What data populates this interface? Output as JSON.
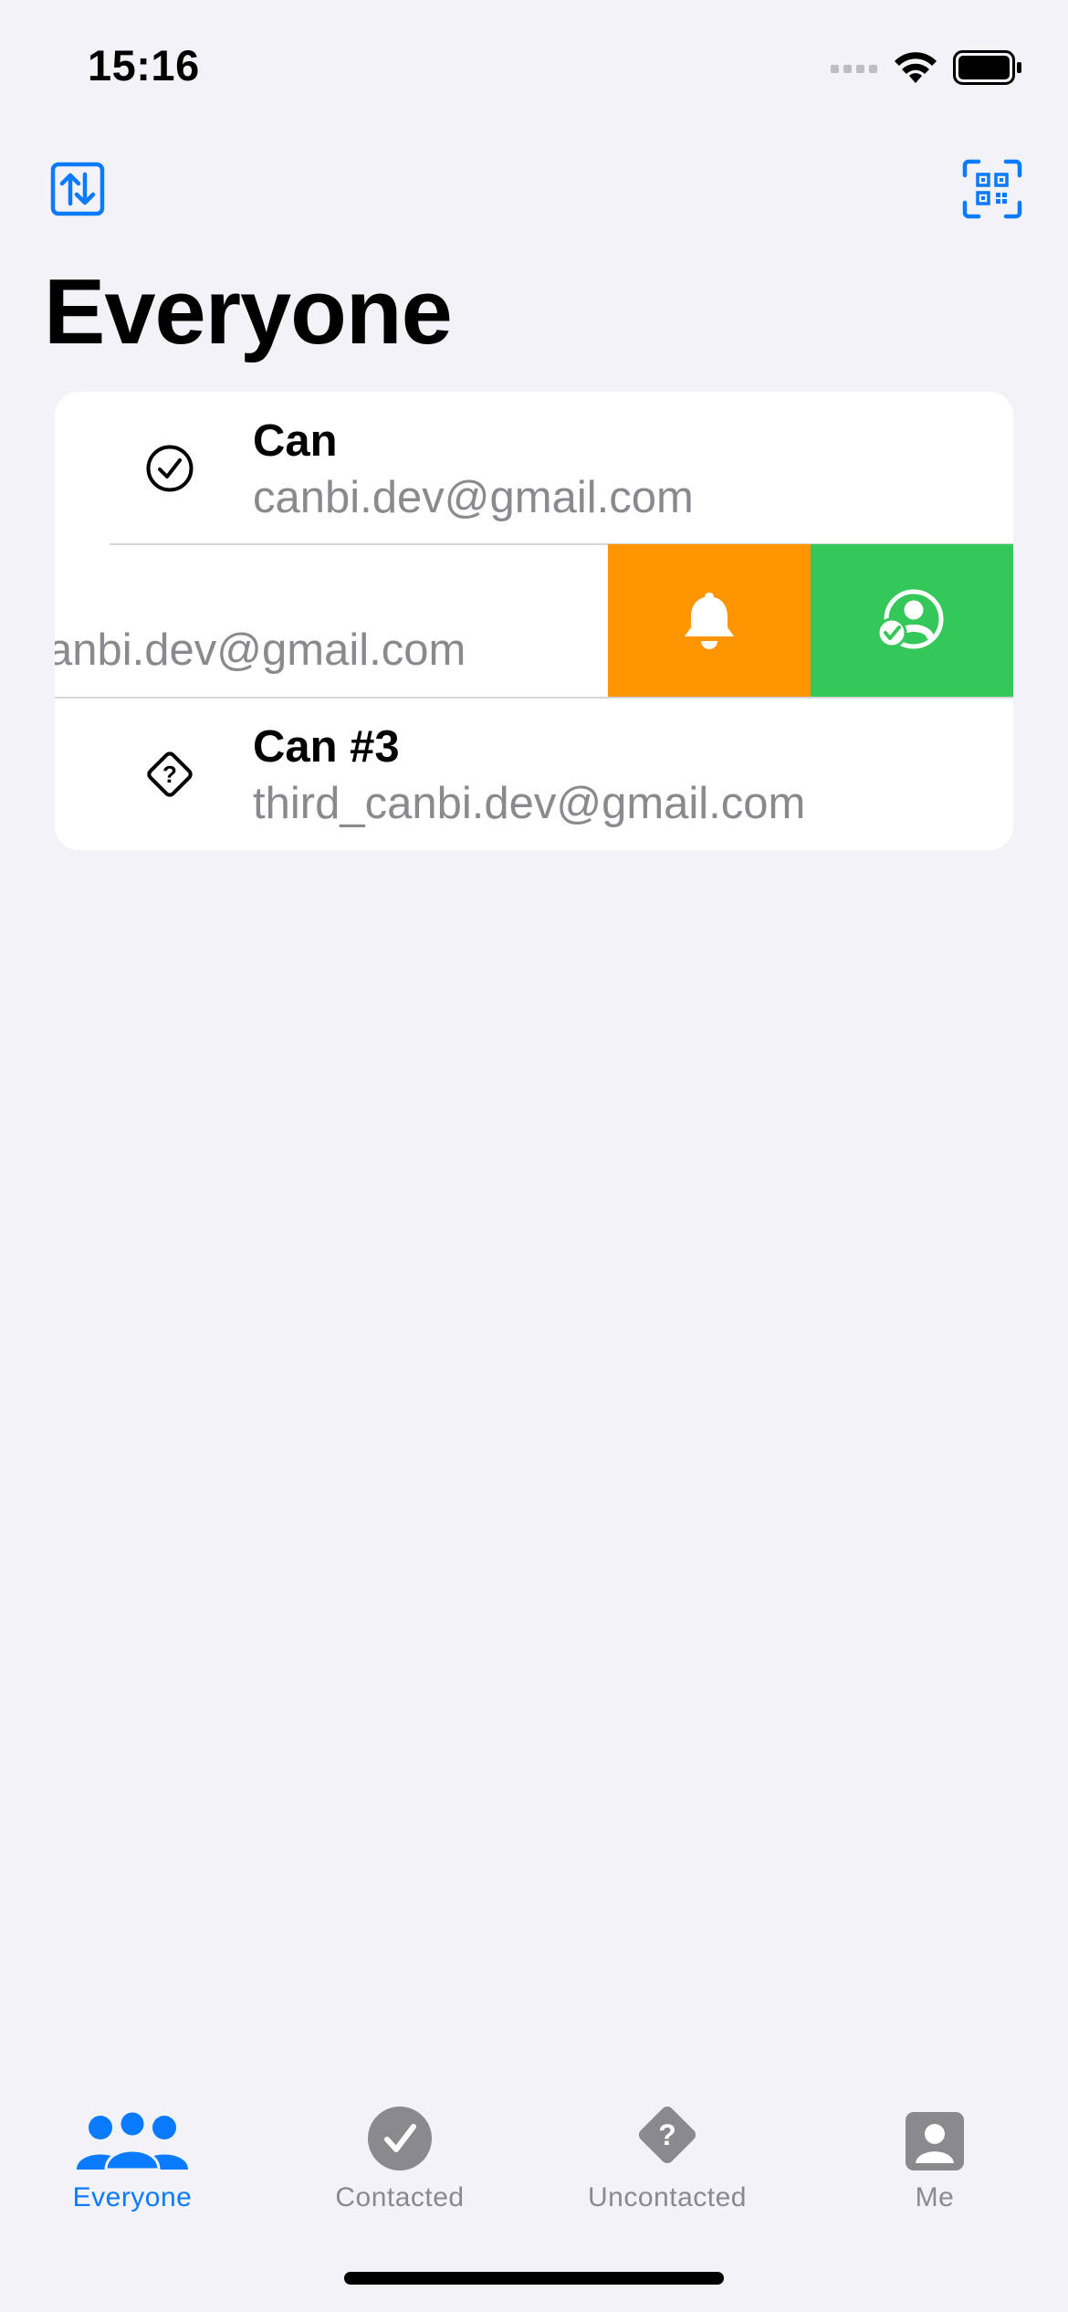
{
  "status_bar": {
    "time": "15:16"
  },
  "nav": {
    "left_icon": "sort-arrows-icon",
    "right_icon": "qr-code-scanner-icon",
    "title": "Everyone"
  },
  "list": {
    "rows": [
      {
        "name": "Can",
        "email": "canbi.dev@gmail.com",
        "status_icon": "checkmark-circle-icon"
      },
      {
        "name": "",
        "email": "anbi.dev@gmail.com",
        "swiped": true
      },
      {
        "name": "Can #3",
        "email": "third_canbi.dev@gmail.com",
        "status_icon": "question-diamond-icon"
      }
    ],
    "swipe_actions": [
      {
        "icon": "bell-icon",
        "color": "#FF9500"
      },
      {
        "icon": "person-checkmark-icon",
        "color": "#34C759"
      }
    ]
  },
  "tabs": [
    {
      "label": "Everyone",
      "icon": "people-icon",
      "active": true
    },
    {
      "label": "Contacted",
      "icon": "checkmark-circle-fill-icon",
      "active": false
    },
    {
      "label": "Uncontacted",
      "icon": "question-diamond-fill-icon",
      "active": false
    },
    {
      "label": "Me",
      "icon": "person-square-icon",
      "active": false
    }
  ],
  "colors": {
    "accent": "#0A7AFF",
    "background": "#F2F2F7",
    "secondary_text": "#8A8A8E"
  }
}
